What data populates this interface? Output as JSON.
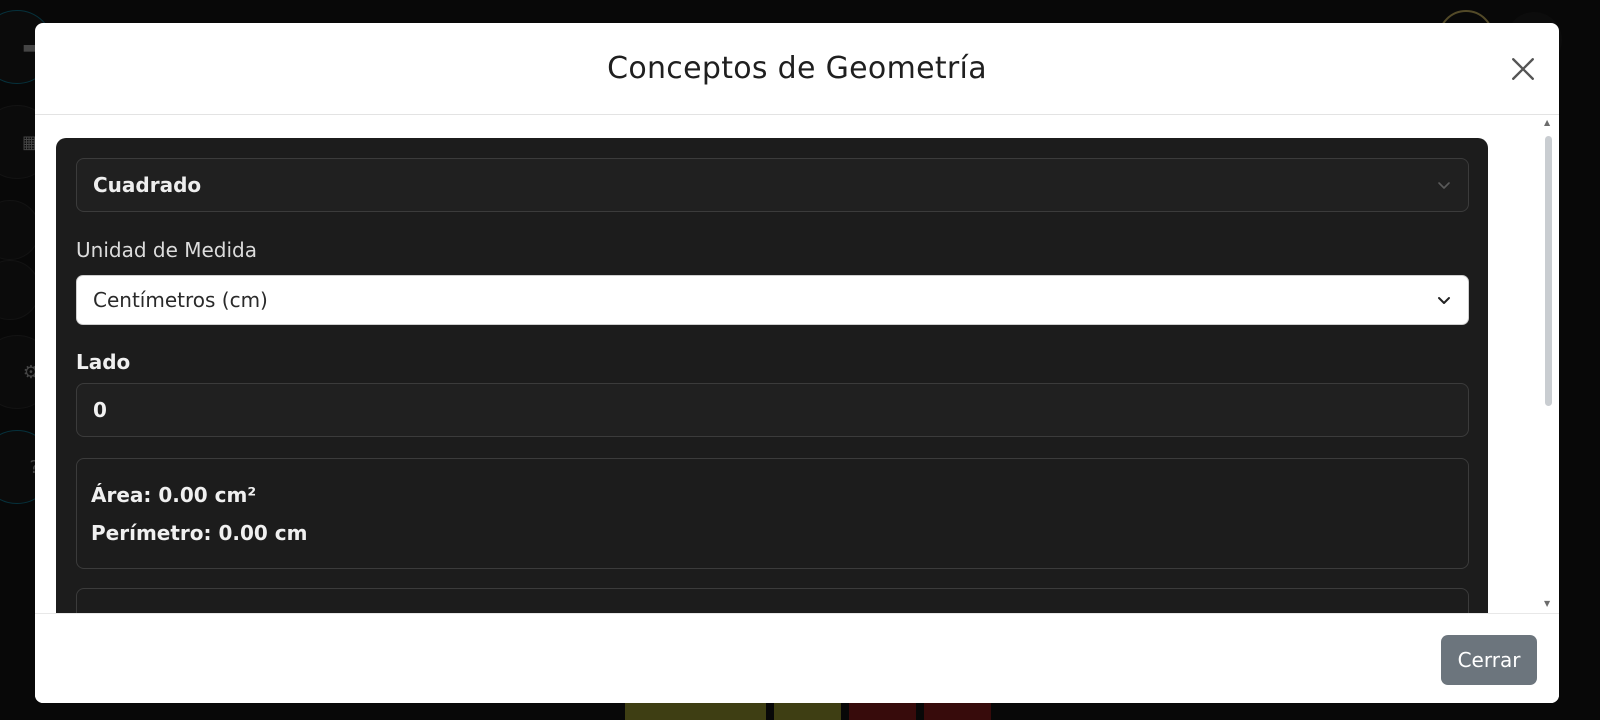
{
  "modal": {
    "title": "Conceptos de Geometría",
    "close_icon": "close-icon",
    "footer": {
      "close_label": "Cerrar"
    }
  },
  "form": {
    "shape_select": {
      "value": "Cuadrado",
      "icon": "chevron-down-icon"
    },
    "unit": {
      "label": "Unidad de Medida",
      "value": "Centímetros (cm)",
      "icon": "chevron-down-icon"
    },
    "side": {
      "label": "Lado",
      "value": "0"
    }
  },
  "results": {
    "area": "Área: 0.00 cm²",
    "perimeter": "Perímetro: 0.00 cm"
  },
  "background": {
    "sidebar_icons": [
      "ruler-icon",
      "calculator-icon",
      "gear-icon",
      "help-icon"
    ],
    "topbar_icons": [
      "user-icon",
      "share-icon"
    ],
    "bottom_button_colors": [
      "#8a8a2a",
      "#8a8a2a",
      "#7a1a1a",
      "#7a1a1a"
    ]
  },
  "colors": {
    "panel_bg": "#1c1c1c",
    "secondary_button": "#6c757d"
  }
}
